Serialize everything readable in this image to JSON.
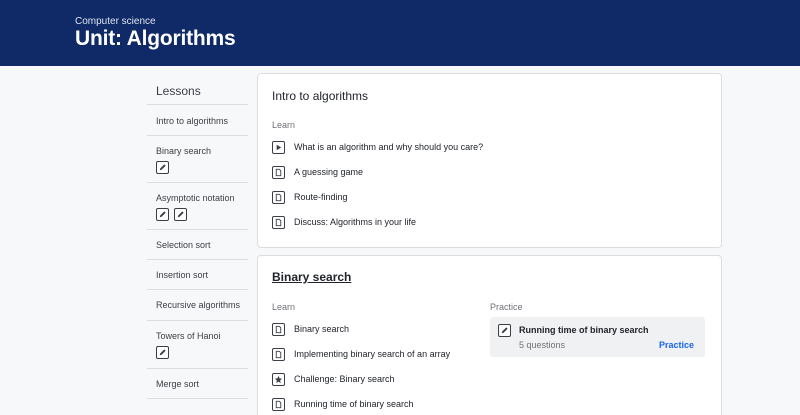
{
  "header": {
    "subject": "Computer science",
    "title": "Unit: Algorithms"
  },
  "sidebar": {
    "heading": "Lessons",
    "items": [
      {
        "label": "Intro to algorithms",
        "icons": []
      },
      {
        "label": "Binary search",
        "icons": [
          "pencil-icon"
        ]
      },
      {
        "label": "Asymptotic notation",
        "icons": [
          "pencil-icon",
          "pencil-icon"
        ]
      },
      {
        "label": "Selection sort",
        "icons": []
      },
      {
        "label": "Insertion sort",
        "icons": []
      },
      {
        "label": "Recursive algorithms",
        "icons": []
      },
      {
        "label": "Towers of Hanoi",
        "icons": [
          "pencil-icon"
        ]
      },
      {
        "label": "Merge sort",
        "icons": []
      }
    ]
  },
  "intro": {
    "title": "Intro to algorithms",
    "learn_label": "Learn",
    "items": [
      {
        "label": "What is an algorithm and why should you care?",
        "icon": "play-icon"
      },
      {
        "label": "A guessing game",
        "icon": "article-icon"
      },
      {
        "label": "Route-finding",
        "icon": "article-icon"
      },
      {
        "label": "Discuss: Algorithms in your life",
        "icon": "article-icon"
      }
    ]
  },
  "binary": {
    "title": "Binary search",
    "learn_label": "Learn",
    "practice_label": "Practice",
    "items": [
      {
        "label": "Binary search",
        "icon": "article-icon"
      },
      {
        "label": "Implementing binary search of an array",
        "icon": "article-icon"
      },
      {
        "label": "Challenge: Binary search",
        "icon": "star-icon"
      },
      {
        "label": "Running time of binary search",
        "icon": "article-icon"
      }
    ],
    "practice": {
      "title": "Running time of binary search",
      "subtitle": "5 questions",
      "link": "Practice"
    }
  },
  "colors": {
    "header": "#0f2a66",
    "link": "#1865f2",
    "background": "#f7f8fa"
  }
}
